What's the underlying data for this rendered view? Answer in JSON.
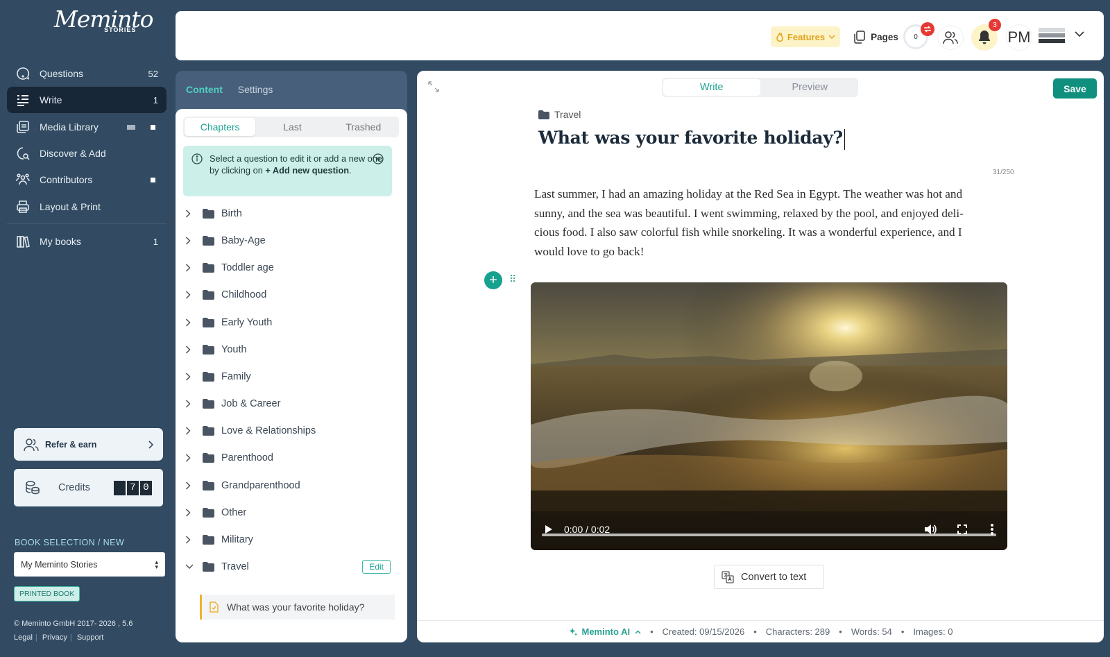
{
  "brand": {
    "logo_text": "Meminto",
    "logo_sub": "STORIES"
  },
  "sidebar": {
    "items": [
      {
        "label": "Questions",
        "count": "52",
        "icon": "question-chat-icon"
      },
      {
        "label": "Write",
        "count": "1",
        "icon": "write-list-icon"
      },
      {
        "label": "Media Library",
        "icon": "media-library-icon"
      },
      {
        "label": "Discover & Add",
        "icon": "discover-search-icon"
      },
      {
        "label": "Contributors",
        "icon": "contributors-icon"
      },
      {
        "label": "Layout & Print",
        "icon": "printer-icon"
      },
      {
        "label": "My books",
        "count": "1",
        "icon": "books-icon"
      }
    ],
    "refer_label": "Refer & earn",
    "credits_label": "Credits",
    "credits_digits": [
      "",
      "7",
      "0"
    ],
    "book_selection_label": "BOOK SELECTION / NEW",
    "book_select_value": "My Meminto Stories",
    "book_badge": "PRINTED BOOK",
    "copyright": "© Meminto GmbH 2017- 2026 , 5.6",
    "links": [
      "Legal",
      "Privacy",
      "Support"
    ]
  },
  "topbar": {
    "features_label": "Features",
    "pages_label": "Pages",
    "pages_count": "0",
    "notifications_count": "3",
    "avatar_initials": "PM"
  },
  "content_panel": {
    "tabs": [
      "Content",
      "Settings"
    ],
    "subtabs": [
      "Chapters",
      "Last",
      "Trashed"
    ],
    "info_text_a": "Select a question to edit it or add a new one by clicking on ",
    "info_text_b": "+ Add new question",
    "info_text_c": ".",
    "chapters": [
      "Birth",
      "Baby-Age",
      "Toddler age",
      "Childhood",
      "Early Youth",
      "Youth",
      "Family",
      "Job & Career",
      "Love & Relationships",
      "Parenthood",
      "Grandparenthood",
      "Other",
      "Military",
      "Travel"
    ],
    "edit_label": "Edit",
    "selected_question": "What was your favorite holiday?"
  },
  "editor": {
    "tabs": [
      "Write",
      "Preview"
    ],
    "save_label": "Save",
    "breadcrumb": "Travel",
    "title": "What was your favorite holiday?",
    "title_count": "31/250",
    "body_lines": [
      "Last summer, I had an amazing holiday at the Red Sea in Egypt. The weather was hot and",
      "sunny, and the sea was beautiful. I went swimming, relaxed by the pool, and enjoyed deli-",
      "cious food. I also saw colorful fish while snorkeling. It was a wonderful experience, and I",
      "would love to go back!"
    ],
    "video_time": "0:00 / 0:02",
    "video_progress": 0,
    "convert_label": "Convert to text",
    "status": {
      "ai_label": "Meminto AI",
      "created": "Created: 09/15/2026",
      "characters": "Characters: 289",
      "words": "Words: 54",
      "images": "Images: 0"
    }
  },
  "colors": {
    "sidebar_bg": "#324b62",
    "accent": "#17a28f",
    "save": "#0f8f7e",
    "features_bg": "#fdf3c9",
    "notify": "#e53935"
  }
}
